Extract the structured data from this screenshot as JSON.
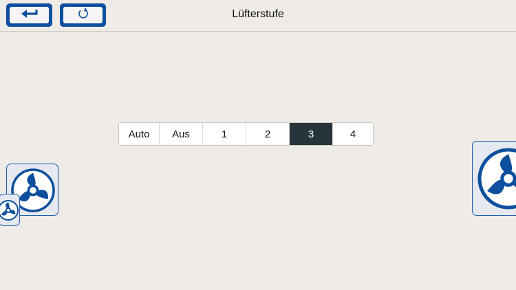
{
  "header": {
    "title": "Lüfterstufe",
    "back_icon": "back-arrow-icon",
    "refresh_icon": "refresh-icon"
  },
  "fan_level": {
    "options": [
      "Auto",
      "Aus",
      "1",
      "2",
      "3",
      "4"
    ],
    "selected": "3"
  },
  "colors": {
    "accent": "#0d4f9e",
    "selected_segment": "#27343c",
    "background": "#efebe6"
  }
}
